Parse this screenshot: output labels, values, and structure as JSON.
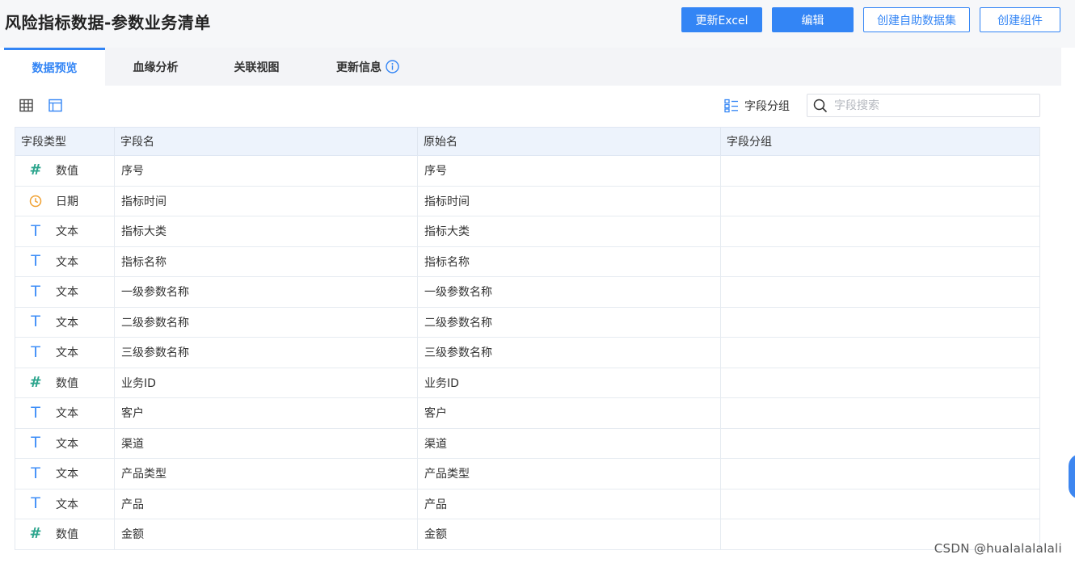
{
  "header": {
    "title": "风险指标数据-参数业务清单",
    "buttons": {
      "update_excel": "更新Excel",
      "edit": "编辑",
      "create_self_dataset": "创建自助数据集",
      "create_component": "创建组件"
    }
  },
  "tabs": [
    {
      "label": "数据预览",
      "active": true
    },
    {
      "label": "血缘分析",
      "active": false
    },
    {
      "label": "关联视图",
      "active": false
    },
    {
      "label": "更新信息",
      "active": false,
      "icon": "info-circle-icon"
    }
  ],
  "toolbar": {
    "view_icons": [
      "table-grid-icon",
      "layout-panel-icon"
    ],
    "group_label": "字段分组",
    "search_placeholder": "字段搜索"
  },
  "table": {
    "columns": [
      "字段类型",
      "字段名",
      "原始名",
      "字段分组"
    ],
    "rows": [
      {
        "type_icon": "#",
        "type": "数值",
        "field": "序号",
        "original": "序号",
        "group": ""
      },
      {
        "type_icon": "clock",
        "type": "日期",
        "field": "指标时间",
        "original": "指标时间",
        "group": ""
      },
      {
        "type_icon": "T",
        "type": "文本",
        "field": "指标大类",
        "original": "指标大类",
        "group": ""
      },
      {
        "type_icon": "T",
        "type": "文本",
        "field": "指标名称",
        "original": "指标名称",
        "group": ""
      },
      {
        "type_icon": "T",
        "type": "文本",
        "field": "一级参数名称",
        "original": "一级参数名称",
        "group": ""
      },
      {
        "type_icon": "T",
        "type": "文本",
        "field": "二级参数名称",
        "original": "二级参数名称",
        "group": ""
      },
      {
        "type_icon": "T",
        "type": "文本",
        "field": "三级参数名称",
        "original": "三级参数名称",
        "group": ""
      },
      {
        "type_icon": "#",
        "type": "数值",
        "field": "业务ID",
        "original": "业务ID",
        "group": ""
      },
      {
        "type_icon": "T",
        "type": "文本",
        "field": "客户",
        "original": "客户",
        "group": ""
      },
      {
        "type_icon": "T",
        "type": "文本",
        "field": "渠道",
        "original": "渠道",
        "group": ""
      },
      {
        "type_icon": "T",
        "type": "文本",
        "field": "产品类型",
        "original": "产品类型",
        "group": ""
      },
      {
        "type_icon": "T",
        "type": "文本",
        "field": "产品",
        "original": "产品",
        "group": ""
      },
      {
        "type_icon": "#",
        "type": "数值",
        "field": "金额",
        "original": "金额",
        "group": ""
      }
    ]
  },
  "watermark": "CSDN @hualalalalali",
  "colors": {
    "accent": "#3385f5",
    "number_icon": "#2ca58d",
    "date_icon": "#f0a030",
    "text_icon": "#3e8ef7"
  }
}
